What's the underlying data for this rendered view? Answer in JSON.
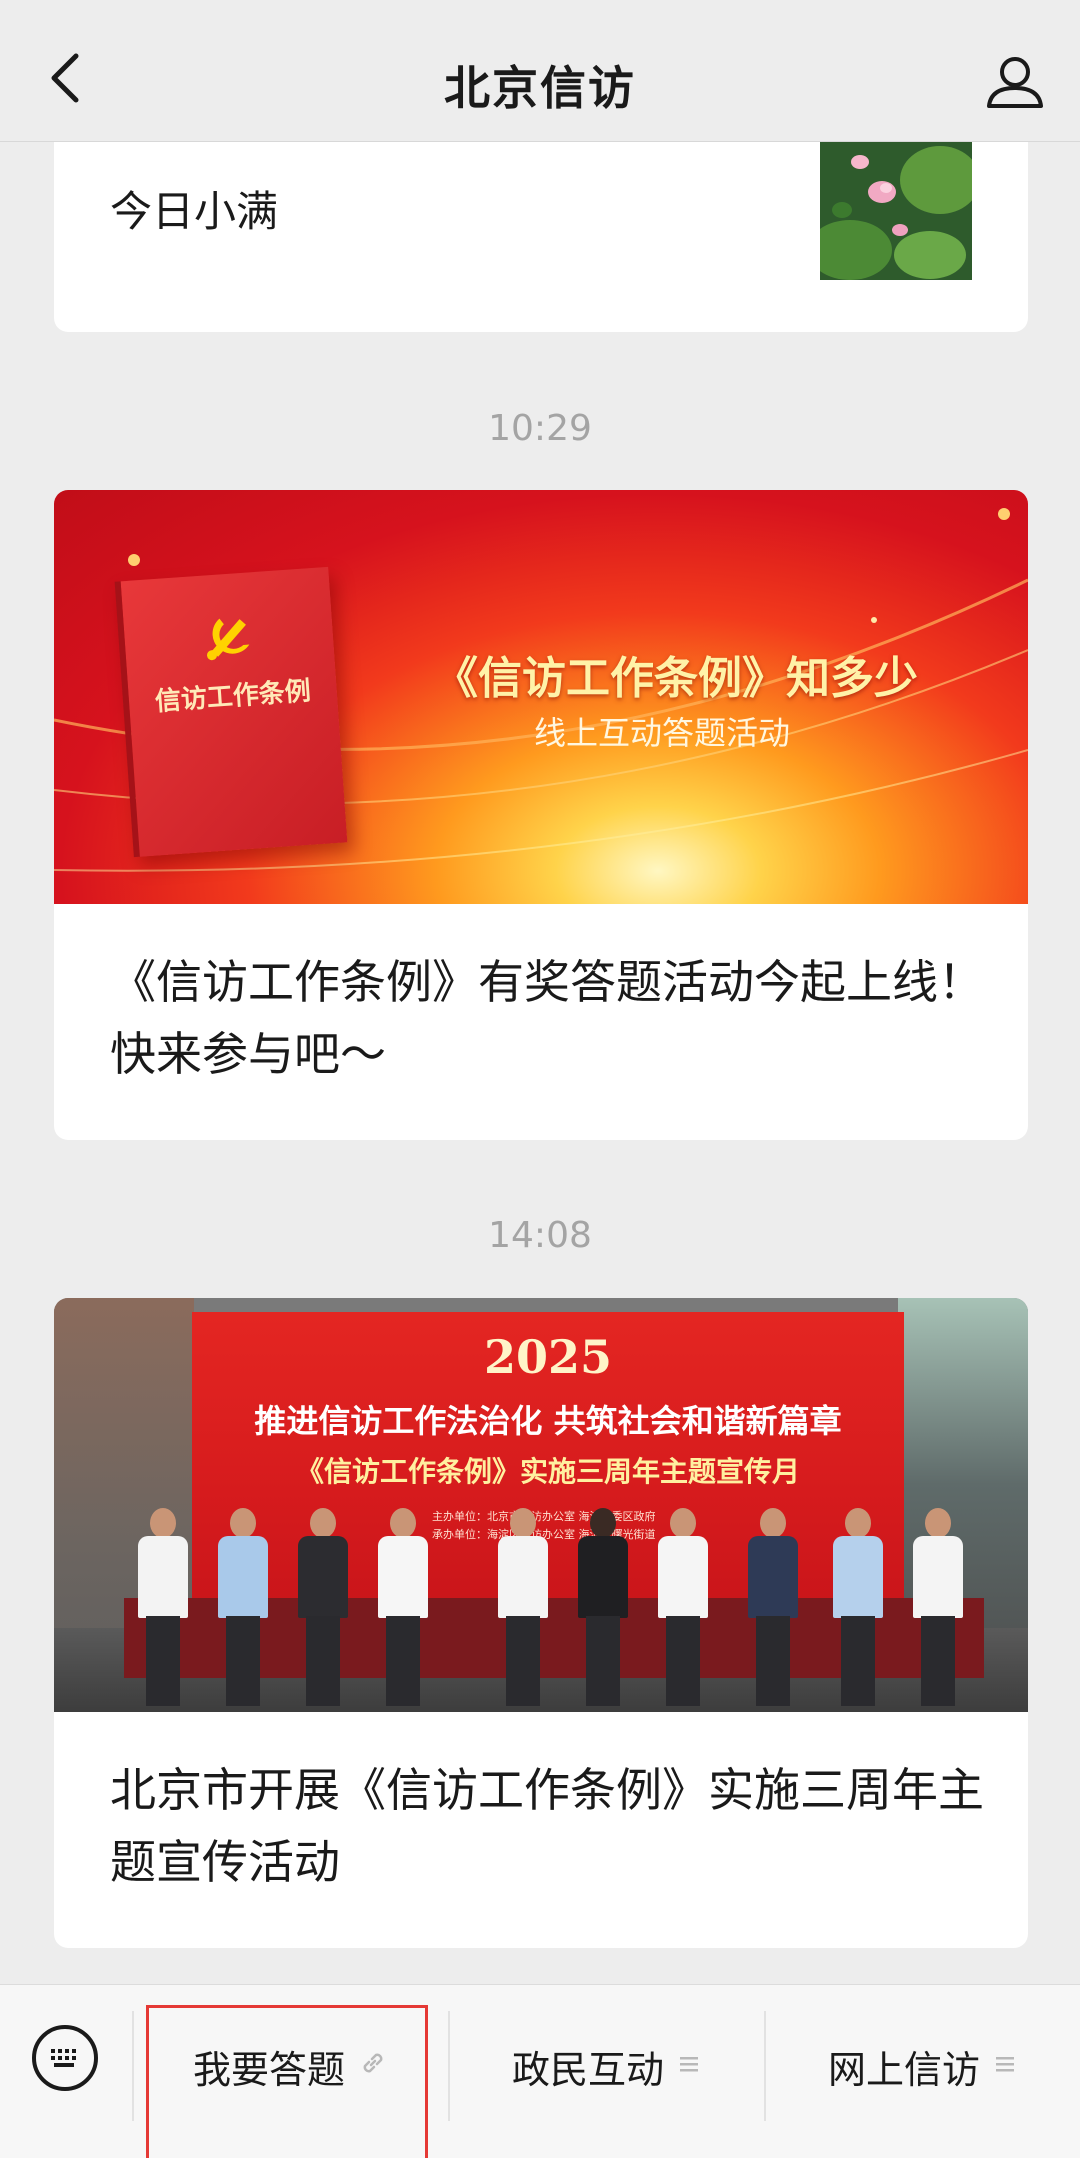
{
  "header": {
    "title": "北京信访"
  },
  "feed": {
    "top_card": {
      "title": "今日小满"
    },
    "messages": [
      {
        "time": "10:29",
        "banner": {
          "book_title": "信访工作条例",
          "headline": "《信访工作条例》知多少",
          "subheadline": "线上互动答题活动"
        },
        "title": "《信访工作条例》有奖答题活动今起上线！快来参与吧～"
      },
      {
        "time": "14:08",
        "photo": {
          "year": "2025",
          "line1": "推进信访工作法治化 共筑社会和谐新篇章",
          "line2": "《信访工作条例》实施三周年主题宣传月",
          "small1": "主办单位：北京市信访办公室 海淀区委区政府",
          "small2": "承办单位：海淀区信访办公室 海淀区曙光街道"
        },
        "title": "北京市开展《信访工作条例》实施三周年主题宣传活动"
      }
    ]
  },
  "bottom_menu": {
    "items": [
      {
        "label": "我要答题",
        "icon": "link-icon"
      },
      {
        "label": "政民互动",
        "icon": "menu-icon"
      },
      {
        "label": "网上信访",
        "icon": "menu-icon"
      }
    ]
  },
  "colors": {
    "highlight": "#e53935",
    "background": "#ededed"
  }
}
